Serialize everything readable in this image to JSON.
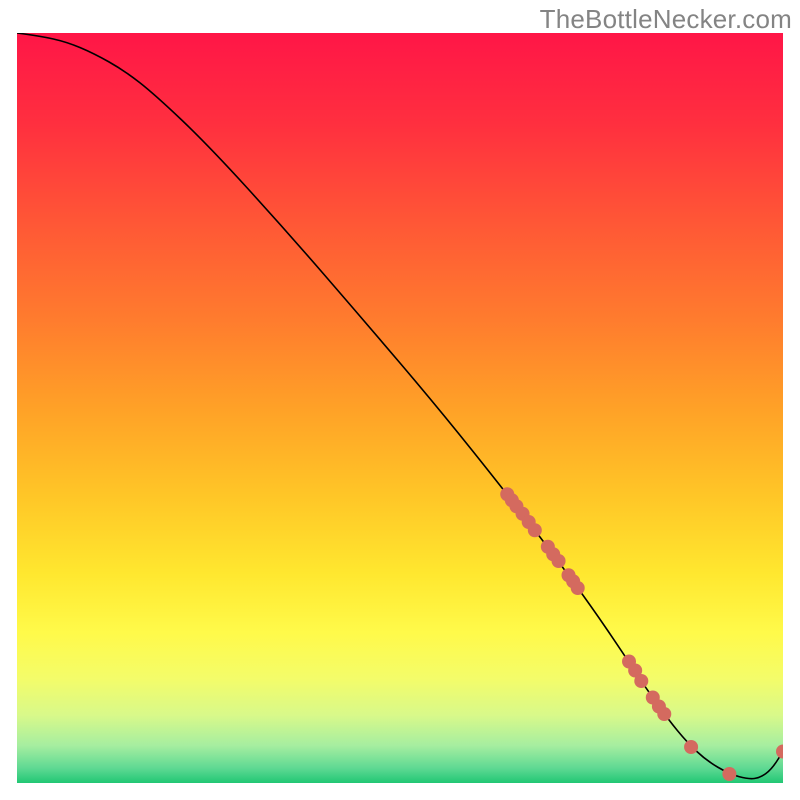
{
  "watermark": "TheBottleNecker.com",
  "chart_data": {
    "type": "line",
    "title": "",
    "xlabel": "",
    "ylabel": "",
    "xlim": [
      0,
      100
    ],
    "ylim": [
      0,
      100
    ],
    "grid": false,
    "legend": false,
    "background_gradient": {
      "stops": [
        {
          "offset": 0.0,
          "color": "#ff1647"
        },
        {
          "offset": 0.12,
          "color": "#ff2f3f"
        },
        {
          "offset": 0.25,
          "color": "#ff5636"
        },
        {
          "offset": 0.38,
          "color": "#ff7b2e"
        },
        {
          "offset": 0.5,
          "color": "#ffa127"
        },
        {
          "offset": 0.62,
          "color": "#ffc727"
        },
        {
          "offset": 0.72,
          "color": "#ffe72f"
        },
        {
          "offset": 0.8,
          "color": "#fffa4a"
        },
        {
          "offset": 0.86,
          "color": "#f4fc69"
        },
        {
          "offset": 0.91,
          "color": "#d8f98a"
        },
        {
          "offset": 0.95,
          "color": "#a6eea0"
        },
        {
          "offset": 0.98,
          "color": "#5fd993"
        },
        {
          "offset": 1.0,
          "color": "#22c774"
        }
      ]
    },
    "series": [
      {
        "name": "curve",
        "color": "#000000",
        "x": [
          0.0,
          3.0,
          6.5,
          10.0,
          14.0,
          18.0,
          25.0,
          35.0,
          45.0,
          55.0,
          64.0,
          70.0,
          75.0,
          79.0,
          82.0,
          85.0,
          87.5,
          90.0,
          93.0,
          95.5,
          97.0,
          98.5,
          100.0
        ],
        "y": [
          100.0,
          99.6,
          98.8,
          97.3,
          95.0,
          91.8,
          85.0,
          73.8,
          62.0,
          50.0,
          38.5,
          30.5,
          23.5,
          17.5,
          12.8,
          8.5,
          5.4,
          3.0,
          1.2,
          0.5,
          0.7,
          1.8,
          4.2
        ]
      }
    ],
    "markers": {
      "name": "points",
      "color": "#d46a5f",
      "radius_px": 7,
      "x": [
        64.0,
        64.6,
        65.2,
        66.0,
        66.8,
        67.6,
        69.3,
        70.0,
        70.7,
        72.0,
        72.6,
        73.2,
        79.9,
        80.7,
        81.5,
        83.0,
        83.8,
        84.5,
        88.0,
        93.0,
        100.0
      ],
      "y": [
        38.5,
        37.7,
        36.9,
        35.9,
        34.8,
        33.7,
        31.5,
        30.5,
        29.6,
        27.7,
        26.9,
        26.0,
        16.2,
        15.0,
        13.6,
        11.4,
        10.2,
        9.2,
        4.8,
        1.2,
        4.2
      ]
    }
  }
}
